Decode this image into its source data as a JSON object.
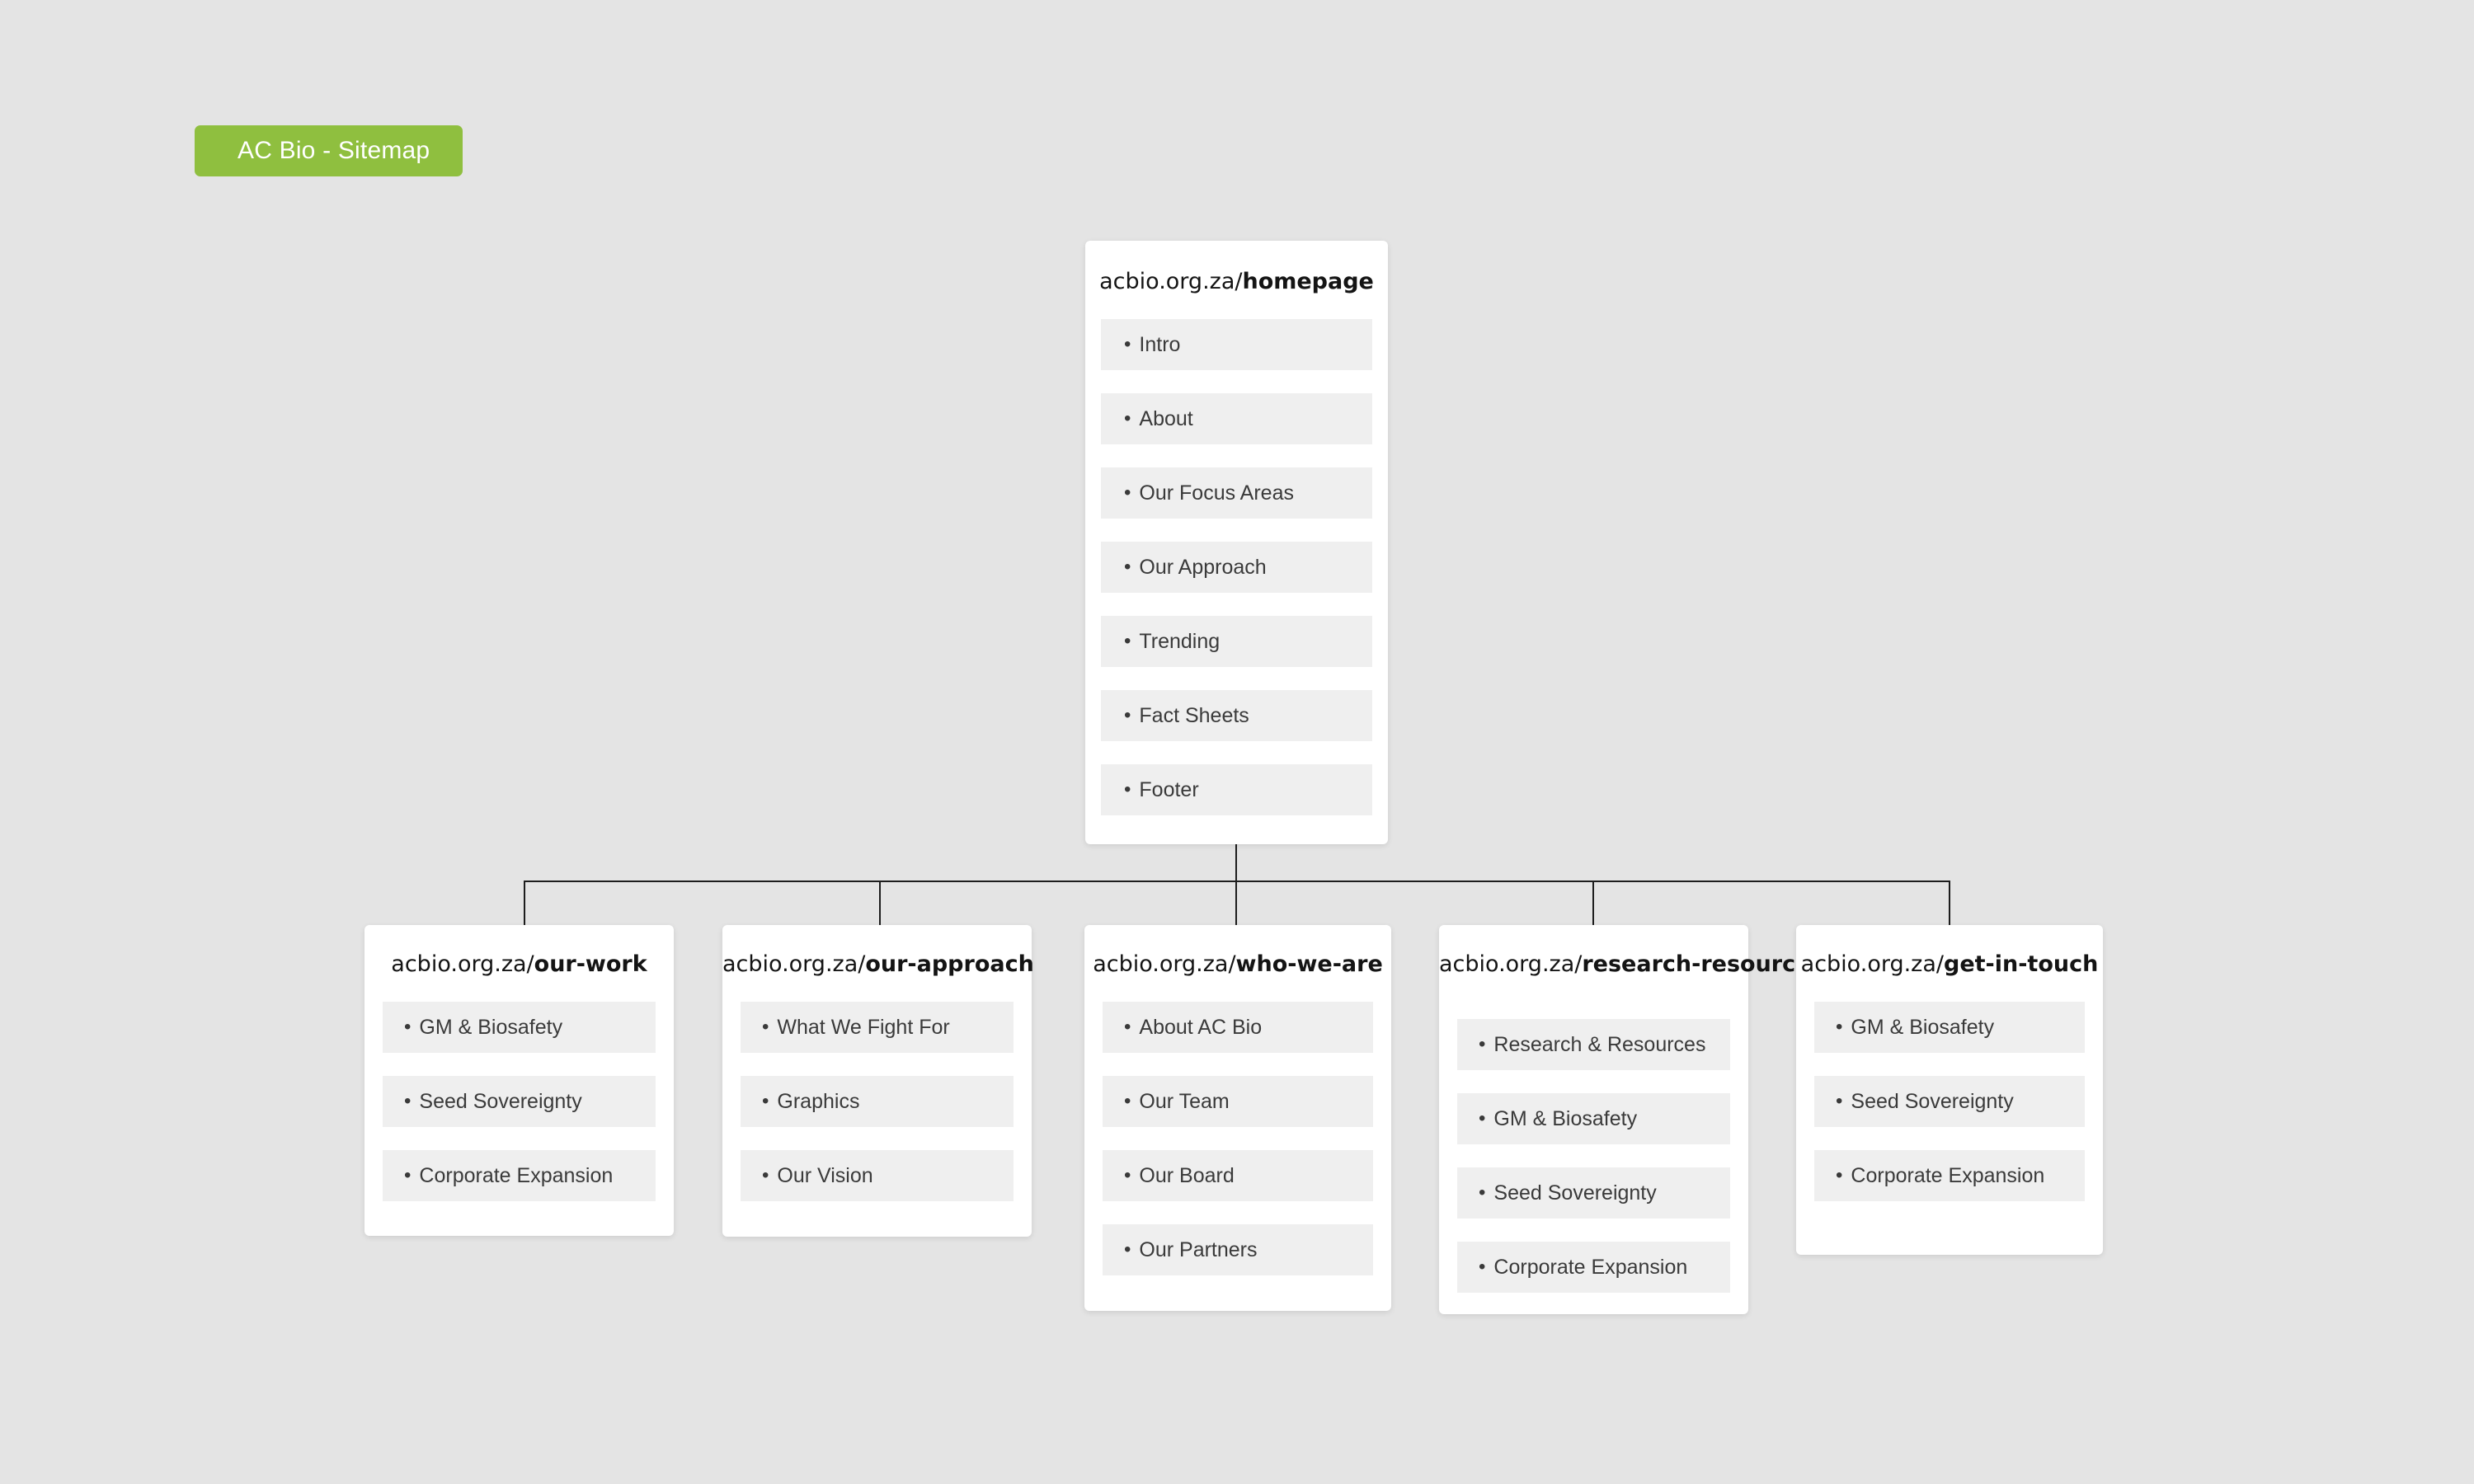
{
  "title_badge": {
    "label": "AC Bio - Sitemap",
    "color": "#8fbf3f"
  },
  "theme": {
    "page_background": "#e4e4e4",
    "card_background": "#ffffff",
    "item_background": "#efefef",
    "connector_color": "#1d1d1d",
    "accent": "#8fbf3f"
  },
  "domain_prefix": "acbio.org.za/",
  "bullet": "•",
  "root": {
    "domain": "acbio.org.za/",
    "slug": "homepage",
    "items": [
      "Intro",
      "About",
      "Our Focus Areas",
      "Our Approach",
      "Trending",
      "Fact Sheets",
      "Footer"
    ]
  },
  "children": [
    {
      "domain": "acbio.org.za/",
      "slug": "our-work",
      "items": [
        "GM & Biosafety",
        "Seed Sovereignty",
        "Corporate Expansion"
      ]
    },
    {
      "domain": "acbio.org.za/",
      "slug": "our-approach",
      "items": [
        "What We Fight For",
        "Graphics",
        "Our Vision"
      ]
    },
    {
      "domain": "acbio.org.za/",
      "slug": "who-we-are",
      "items": [
        "About AC Bio",
        "Our Team",
        "Our Board",
        "Our Partners"
      ]
    },
    {
      "domain": "acbio.org.za/",
      "slug": "research-resources",
      "items": [
        "Research & Resources",
        "GM & Biosafety",
        "Seed Sovereignty",
        "Corporate Expansion"
      ]
    },
    {
      "domain": "acbio.org.za/",
      "slug": "get-in-touch",
      "items": [
        "GM & Biosafety",
        "Seed Sovereignty",
        "Corporate Expansion"
      ]
    }
  ]
}
